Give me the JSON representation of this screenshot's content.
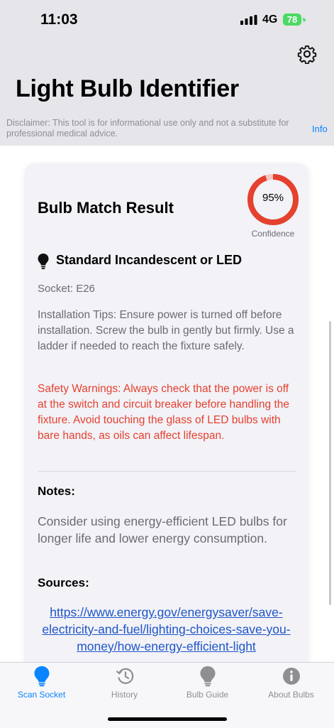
{
  "status_bar": {
    "time": "11:03",
    "network": "4G",
    "battery": "78"
  },
  "header": {
    "title": "Light Bulb Identifier",
    "disclaimer": "Disclaimer: This tool is for informational use only and not a substitute for professional medical advice.",
    "info_label": "Info",
    "settings_icon": "gear-icon"
  },
  "result": {
    "title": "Bulb Match Result",
    "confidence_value": "95%",
    "confidence_fraction": 0.95,
    "confidence_label": "Confidence",
    "bulb_type": "Standard Incandescent or LED",
    "bulb_icon": "lightbulb-icon",
    "socket": "Socket: E26",
    "installation_tips": "Installation Tips: Ensure power is turned off before installation. Screw the bulb in gently but firmly. Use a ladder if needed to reach the fixture safely.",
    "safety_warnings": "Safety Warnings: Always check that the power is off at the switch and circuit breaker before handling the fixture. Avoid touching the glass of LED bulbs with bare hands, as oils can affect lifespan.",
    "notes_heading": "Notes:",
    "notes": "Consider using energy-efficient LED bulbs for longer life and lower energy consumption.",
    "sources_heading": "Sources:",
    "source_url": "https://www.energy.gov/energysaver/save-electricity-and-fuel/lighting-choices-save-you-money/how-energy-efficient-light"
  },
  "tabs": [
    {
      "label": "Scan Socket",
      "icon": "lightbulb-icon",
      "active": true
    },
    {
      "label": "History",
      "icon": "history-icon",
      "active": false
    },
    {
      "label": "Bulb Guide",
      "icon": "lightbulb-icon",
      "active": false
    },
    {
      "label": "About Bulbs",
      "icon": "info-icon",
      "active": false
    }
  ],
  "colors": {
    "accent": "#0a84ff",
    "confidence_ring": "#e5412f",
    "warning_text": "#e5412f",
    "battery": "#4cd964",
    "link": "#1e55c8"
  }
}
